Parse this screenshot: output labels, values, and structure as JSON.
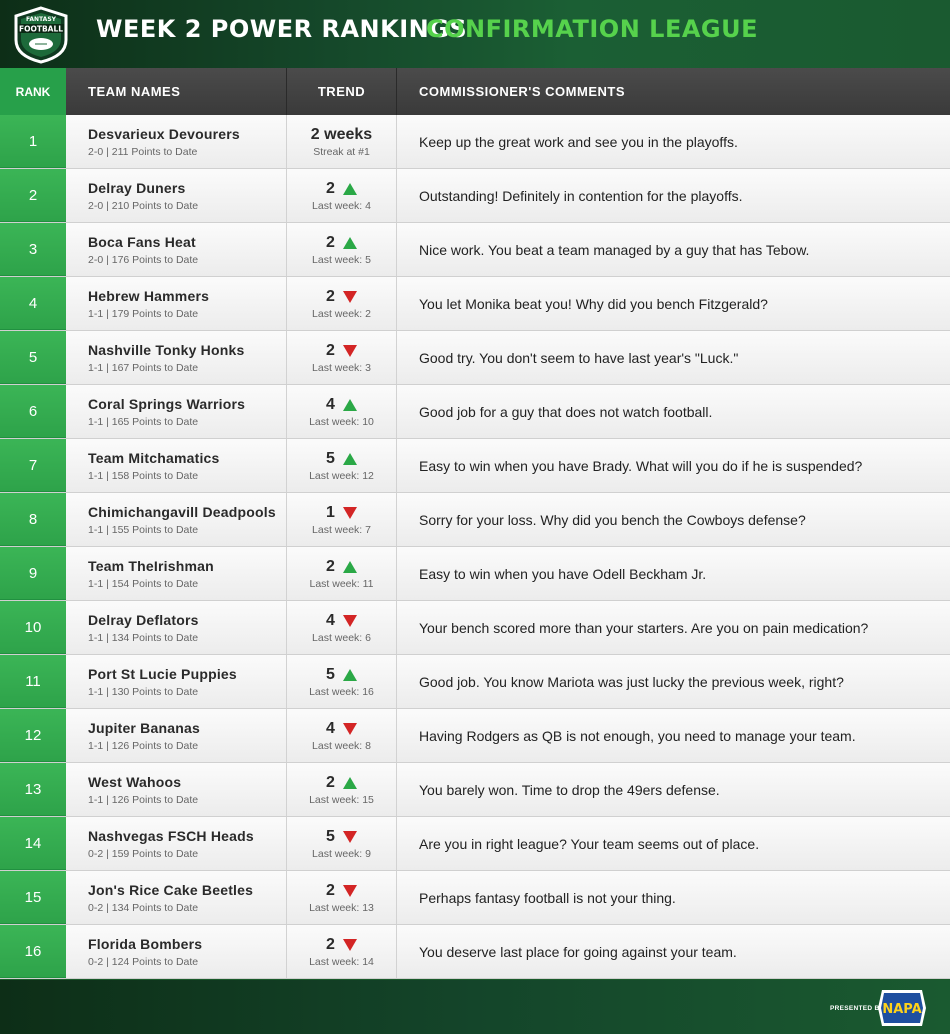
{
  "header": {
    "logo_top": "FANTASY",
    "logo_bottom": "FOOTBALL",
    "title": "WEEK 2 POWER RANKINGS",
    "league": "CONFIRMATION LEAGUE"
  },
  "columns": {
    "rank": "RANK",
    "team": "TEAM NAMES",
    "trend": "TREND",
    "comments": "COMMISSIONER'S COMMENTS"
  },
  "rows": [
    {
      "rank": "1",
      "team": "Desvarieux Devourers",
      "sub": "2-0 | 211 Points to Date",
      "trend": "2 weeks",
      "trend_sub": "Streak at #1",
      "dir": "none",
      "comment": "Keep up the great work and see you in the playoffs."
    },
    {
      "rank": "2",
      "team": "Delray Duners",
      "sub": "2-0 | 210 Points to Date",
      "trend": "2",
      "trend_sub": "Last week: 4",
      "dir": "up",
      "comment": "Outstanding!  Definitely in contention for the playoffs."
    },
    {
      "rank": "3",
      "team": "Boca Fans Heat",
      "sub": "2-0 | 176 Points to Date",
      "trend": "2",
      "trend_sub": "Last week: 5",
      "dir": "up",
      "comment": "Nice work.  You beat a team managed by a guy that has Tebow."
    },
    {
      "rank": "4",
      "team": "Hebrew Hammers",
      "sub": "1-1 | 179 Points to Date",
      "trend": "2",
      "trend_sub": "Last week: 2",
      "dir": "down",
      "comment": "You let Monika beat you!  Why did you bench Fitzgerald?"
    },
    {
      "rank": "5",
      "team": "Nashville Tonky Honks",
      "sub": "1-1 | 167 Points to Date",
      "trend": "2",
      "trend_sub": "Last week: 3",
      "dir": "down",
      "comment": "Good try.  You don't seem to have last year's \"Luck.\""
    },
    {
      "rank": "6",
      "team": "Coral Springs Warriors",
      "sub": "1-1 | 165 Points to Date",
      "trend": "4",
      "trend_sub": "Last week: 10",
      "dir": "up",
      "comment": "Good job for a guy that does not watch football."
    },
    {
      "rank": "7",
      "team": "Team Mitchamatics",
      "sub": "1-1 | 158 Points to Date",
      "trend": "5",
      "trend_sub": "Last week: 12",
      "dir": "up",
      "comment": "Easy to win when you have Brady.  What will you do if he is suspended?"
    },
    {
      "rank": "8",
      "team": "Chimichangavill Deadpools",
      "sub": "1-1 | 155 Points to Date",
      "trend": "1",
      "trend_sub": "Last week: 7",
      "dir": "down",
      "comment": "Sorry for your loss.  Why did you bench the Cowboys defense?"
    },
    {
      "rank": "9",
      "team": "Team TheIrishman",
      "sub": "1-1 | 154 Points to Date",
      "trend": "2",
      "trend_sub": "Last week: 11",
      "dir": "up",
      "comment": "Easy to win when you have Odell Beckham Jr."
    },
    {
      "rank": "10",
      "team": "Delray Deflators",
      "sub": "1-1 | 134 Points to Date",
      "trend": "4",
      "trend_sub": "Last week: 6",
      "dir": "down",
      "comment": "Your bench scored more than your starters.  Are you on pain medication?"
    },
    {
      "rank": "11",
      "team": "Port St Lucie Puppies",
      "sub": "1-1 | 130 Points to Date",
      "trend": "5",
      "trend_sub": "Last week: 16",
      "dir": "up",
      "comment": "Good job.  You know Mariota was just lucky the previous week, right?"
    },
    {
      "rank": "12",
      "team": "Jupiter Bananas",
      "sub": "1-1 | 126 Points to Date",
      "trend": "4",
      "trend_sub": "Last week: 8",
      "dir": "down",
      "comment": "Having Rodgers as QB is not enough, you need to manage your team."
    },
    {
      "rank": "13",
      "team": "West Wahoos",
      "sub": "1-1 | 126 Points to Date",
      "trend": "2",
      "trend_sub": "Last week: 15",
      "dir": "up",
      "comment": "You barely won.  Time to drop the 49ers defense."
    },
    {
      "rank": "14",
      "team": "Nashvegas FSCH Heads",
      "sub": "0-2 | 159 Points to Date",
      "trend": "5",
      "trend_sub": "Last week: 9",
      "dir": "down",
      "comment": "Are you in right league?  Your team seems out of place."
    },
    {
      "rank": "15",
      "team": "Jon's Rice Cake Beetles",
      "sub": "0-2 | 134 Points to Date",
      "trend": "2",
      "trend_sub": "Last week: 13",
      "dir": "down",
      "comment": "Perhaps fantasy football is not your thing."
    },
    {
      "rank": "16",
      "team": "Florida Bombers",
      "sub": "0-2 | 124 Points to Date",
      "trend": "2",
      "trend_sub": "Last week: 14",
      "dir": "down",
      "comment": "You deserve last place for going against your team."
    }
  ],
  "footer": {
    "presented_by": "PRESENTED BY",
    "sponsor": "NAPA"
  },
  "colors": {
    "up": "#2aa846",
    "down": "#d32525",
    "league": "#56d24c",
    "rank_bg": "#2ea34a"
  }
}
